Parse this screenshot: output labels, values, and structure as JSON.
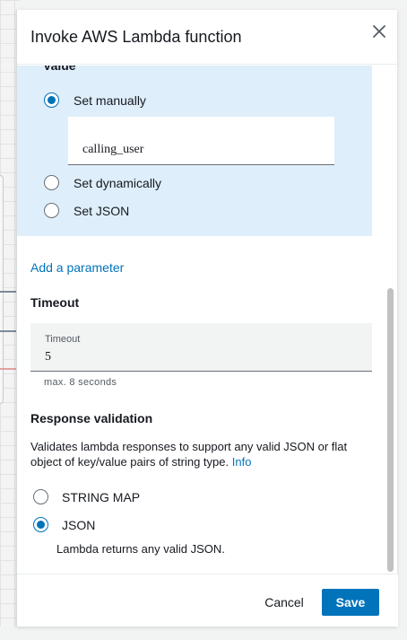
{
  "modal": {
    "title": "Invoke AWS Lambda function",
    "close_icon": "close-icon"
  },
  "value_section": {
    "label": "Value",
    "options": [
      {
        "label": "Set manually",
        "checked": true
      },
      {
        "label": "Set dynamically",
        "checked": false
      },
      {
        "label": "Set JSON",
        "checked": false
      }
    ],
    "manual_value": "calling_user"
  },
  "add_parameter_link": "Add a parameter",
  "timeout": {
    "heading": "Timeout",
    "field_label": "Timeout",
    "value": "5",
    "hint": "max. 8 seconds"
  },
  "response_validation": {
    "heading": "Response validation",
    "description": "Validates lambda responses to support any valid JSON or flat object of key/value pairs of string type.",
    "info_link": "Info",
    "options": [
      {
        "label": "STRING MAP",
        "checked": false
      },
      {
        "label": "JSON",
        "checked": true
      }
    ],
    "json_note": "Lambda returns any valid JSON."
  },
  "footer": {
    "cancel_label": "Cancel",
    "save_label": "Save"
  },
  "colors": {
    "accent": "#0073bb",
    "value_panel_bg": "#deeefa"
  }
}
